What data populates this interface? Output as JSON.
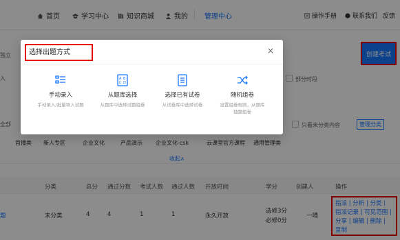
{
  "nav": {
    "home": "首页",
    "learning": "学习中心",
    "knowledge_mall": "知识商城",
    "mine": "我的",
    "admin": "管理中心",
    "manual": "操作手册",
    "contact": "联系我们",
    "feedback": "反馈"
  },
  "page": {
    "filter_hint": "独立",
    "create_exam_label": "创建考试",
    "import_hint": "入",
    "partial_period": "部分时段",
    "all_label": "全部",
    "only_uncategorized": "只看未分类内容",
    "manage_categories": "管理分类",
    "tags": [
      "首播类",
      "新人专区",
      "企业文化",
      "产品演示",
      "企业文化-csk",
      "云课堂官方课程",
      "通用管理类"
    ],
    "collapse_label": "收起∧"
  },
  "table": {
    "headers": [
      "分类",
      "总分",
      "通过分数",
      "考试人数",
      "通过人数",
      "开放时间",
      "学分",
      "创建人",
      "操作"
    ],
    "row": {
      "lead": "题",
      "category": "未分类",
      "total_score": "4",
      "pass_score": "4",
      "exam_count": "1",
      "pass_count": "1",
      "open_time": "永久开放",
      "credit_elective": "选修3分",
      "credit_required": "必修0分",
      "creator": "一晴",
      "ops_text": "指派 | 分析 | 分类 | 指派记录 | 可见范围 | 分享 | 编辑 | 删除 | 复制"
    }
  },
  "modal": {
    "title": "选择出题方式",
    "close": "×",
    "options": [
      {
        "icon": "list-icon",
        "title": "手动录入",
        "desc": "手动录入/批量导入试题"
      },
      {
        "icon": "question-bank-icon",
        "title": "从题库选择",
        "desc": "从题库中选择试题组卷"
      },
      {
        "icon": "document-icon",
        "title": "选择已有试卷",
        "desc": "从试卷库中选择试卷"
      },
      {
        "icon": "shuffle-icon",
        "title": "随机组卷",
        "desc": "设置组卷规则，从题库抽题组卷"
      }
    ]
  },
  "colors": {
    "accent": "#1677ff",
    "highlight": "#e60000"
  }
}
